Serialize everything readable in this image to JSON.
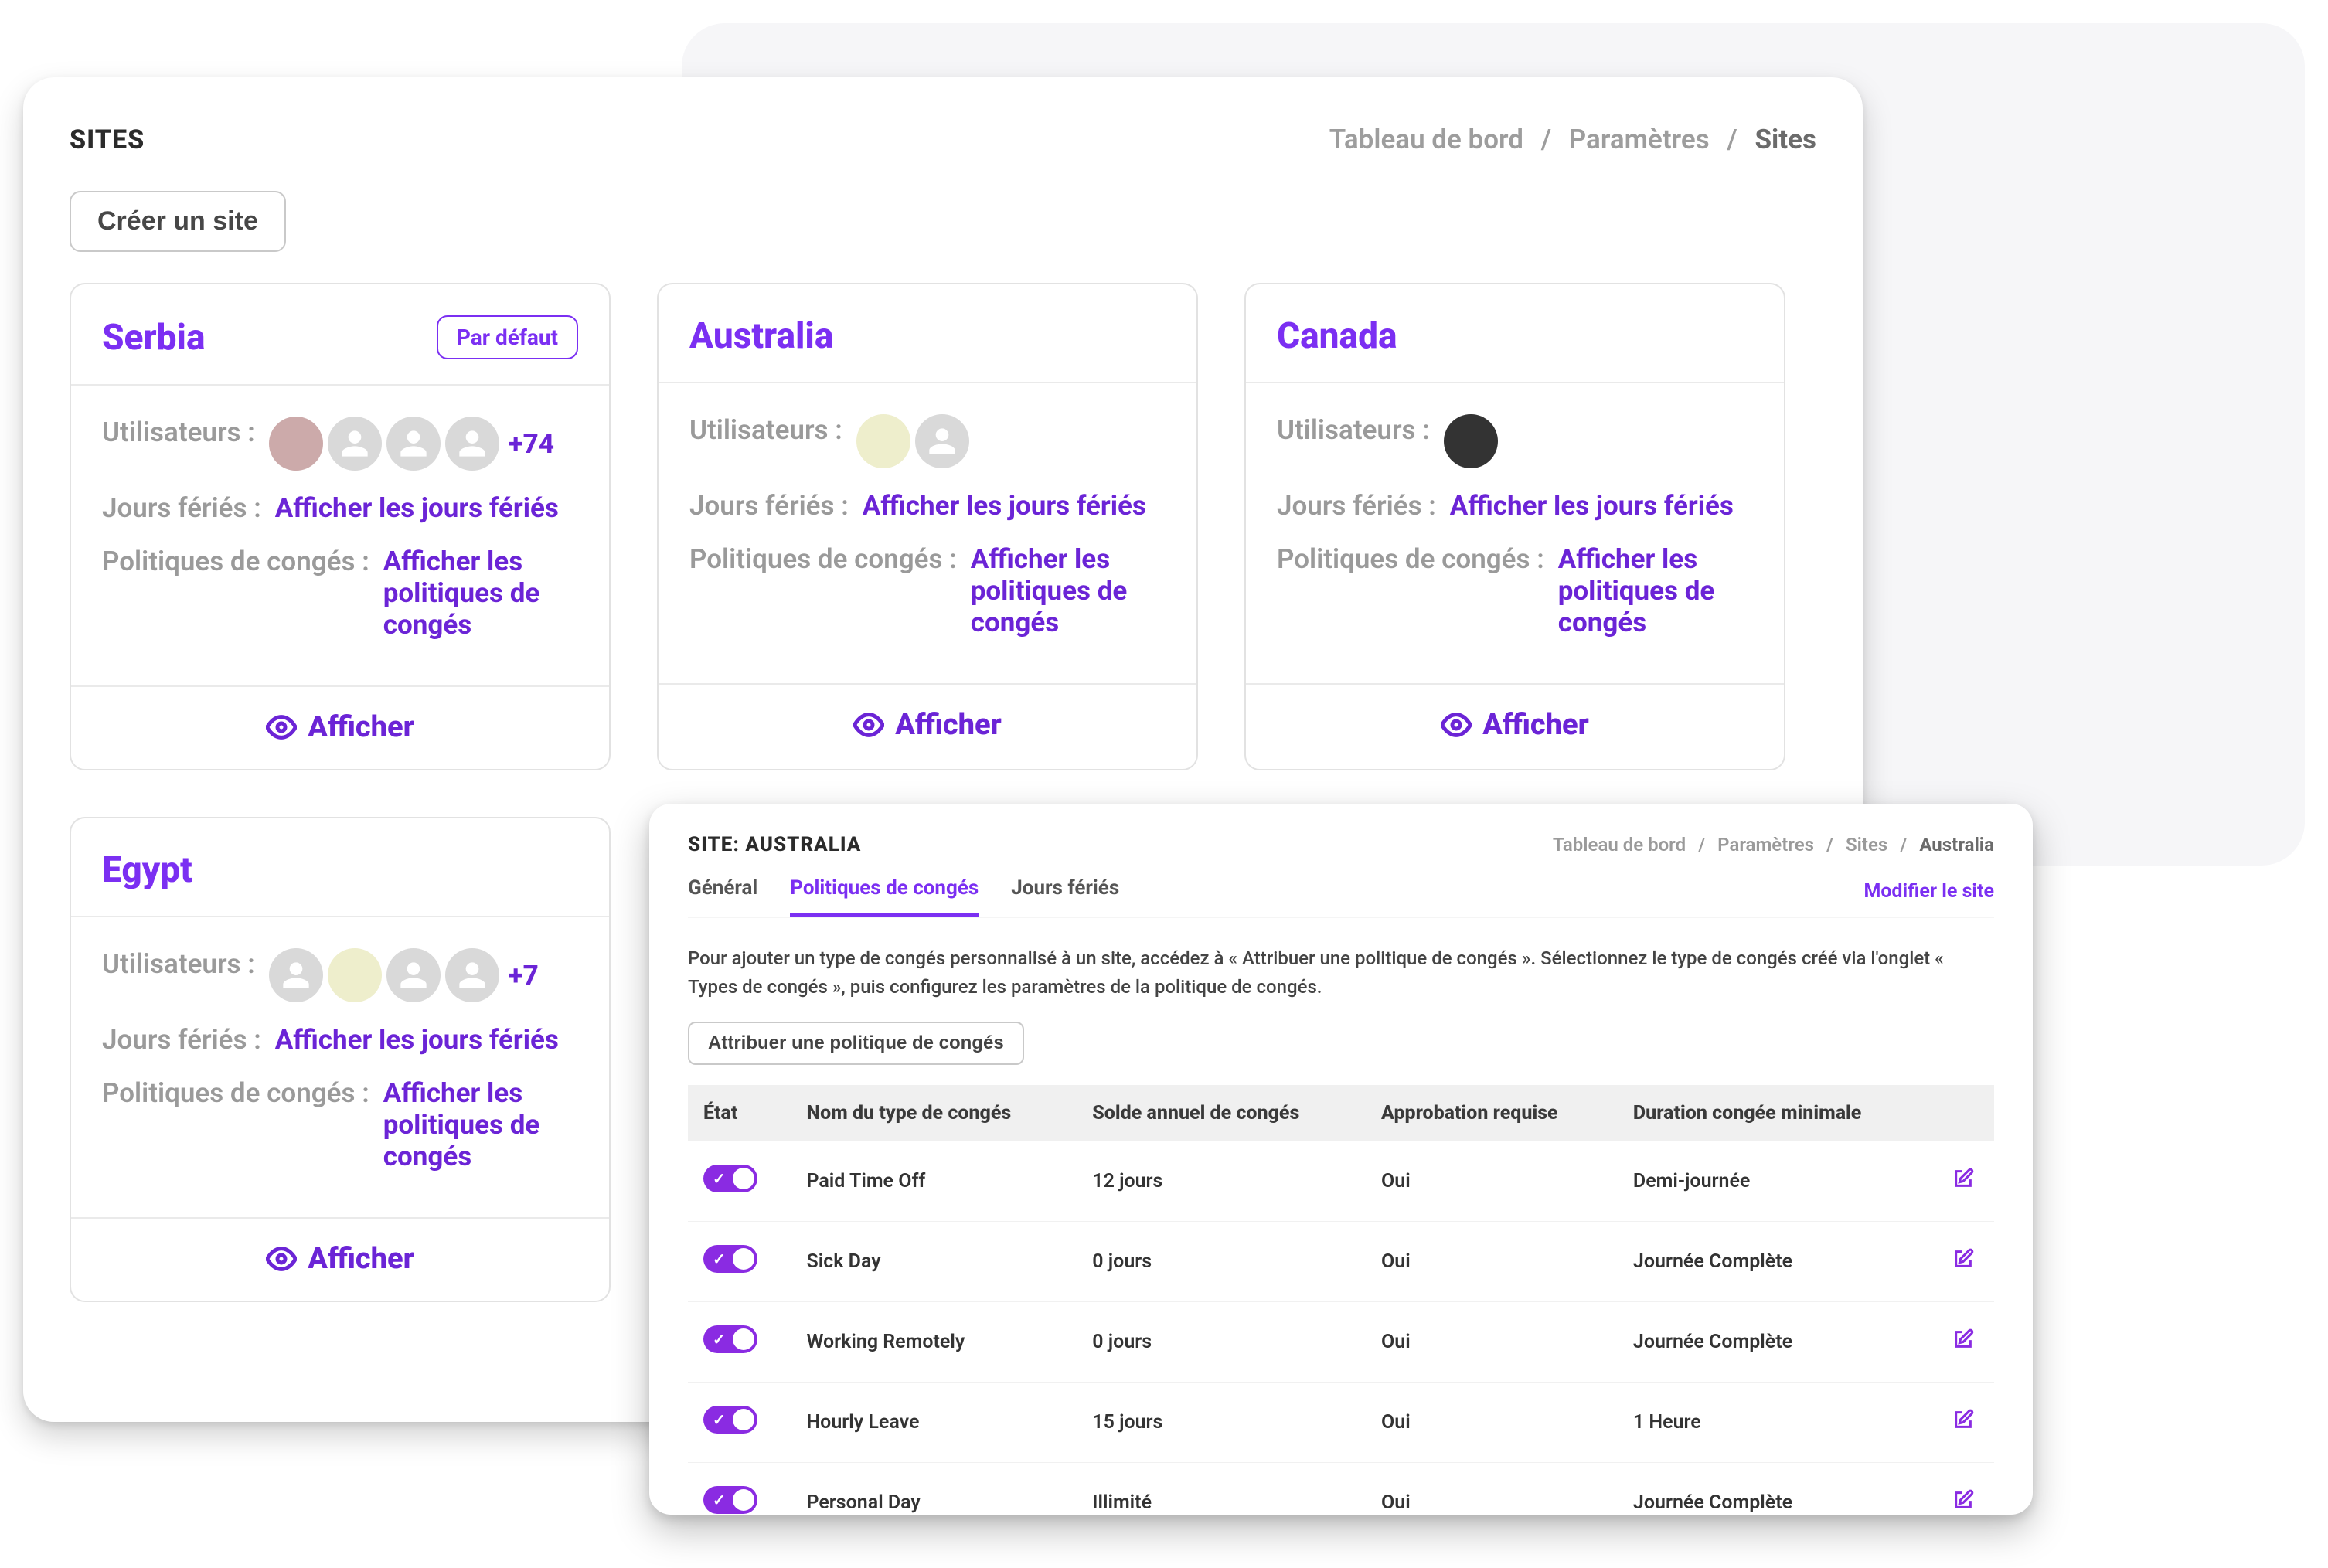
{
  "header": {
    "title": "SITES",
    "breadcrumb": [
      "Tableau de bord",
      "Paramètres",
      "Sites"
    ],
    "create_button": "Créer un site"
  },
  "labels": {
    "users": "Utilisateurs :",
    "holidays": "Jours fériés :",
    "holidays_link": "Afficher les jours fériés",
    "policies": "Politiques de congés :",
    "policies_link": "Afficher les politiques de congés",
    "view": "Afficher",
    "default_badge": "Par défaut"
  },
  "sites": [
    {
      "name": "Serbia",
      "is_default": true,
      "avatars": [
        "photo",
        "placeholder",
        "placeholder",
        "placeholder"
      ],
      "more": "+74"
    },
    {
      "name": "Australia",
      "is_default": false,
      "avatars": [
        "photo2",
        "placeholder"
      ],
      "more": ""
    },
    {
      "name": "Canada",
      "is_default": false,
      "avatars": [
        "photo3"
      ],
      "more": ""
    },
    {
      "name": "Egypt",
      "is_default": false,
      "avatars": [
        "placeholder",
        "photo2",
        "placeholder",
        "placeholder"
      ],
      "more": "+7"
    }
  ],
  "detail": {
    "title": "SITE: AUSTRALIA",
    "breadcrumb": [
      "Tableau de bord",
      "Paramètres",
      "Sites",
      "Australia"
    ],
    "tabs": [
      "Général",
      "Politiques de congés",
      "Jours fériés"
    ],
    "active_tab": "Politiques de congés",
    "modify_link": "Modifier le site",
    "help_text": "Pour ajouter un type de congés personnalisé à un site, accédez à « Attribuer une politique de congés ». Sélectionnez le type de congés créé via l'onglet « Types de congés », puis configurez les paramètres de la politique de congés.",
    "assign_button": "Attribuer une politique de congés",
    "columns": [
      "État",
      "Nom du type de congés",
      "Solde annuel de congés",
      "Approbation requise",
      "Duration congée minimale"
    ],
    "rows": [
      {
        "enabled": true,
        "name": "Paid Time Off",
        "balance": "12 jours",
        "approval": "Oui",
        "min": "Demi-journée"
      },
      {
        "enabled": true,
        "name": "Sick Day",
        "balance": "0 jours",
        "approval": "Oui",
        "min": "Journée Complète"
      },
      {
        "enabled": true,
        "name": "Working Remotely",
        "balance": "0 jours",
        "approval": "Oui",
        "min": "Journée Complète"
      },
      {
        "enabled": true,
        "name": "Hourly Leave",
        "balance": "15 jours",
        "approval": "Oui",
        "min": "1 Heure"
      },
      {
        "enabled": true,
        "name": "Personal Day",
        "balance": "Illimité",
        "approval": "Oui",
        "min": "Journée Complète"
      }
    ]
  }
}
